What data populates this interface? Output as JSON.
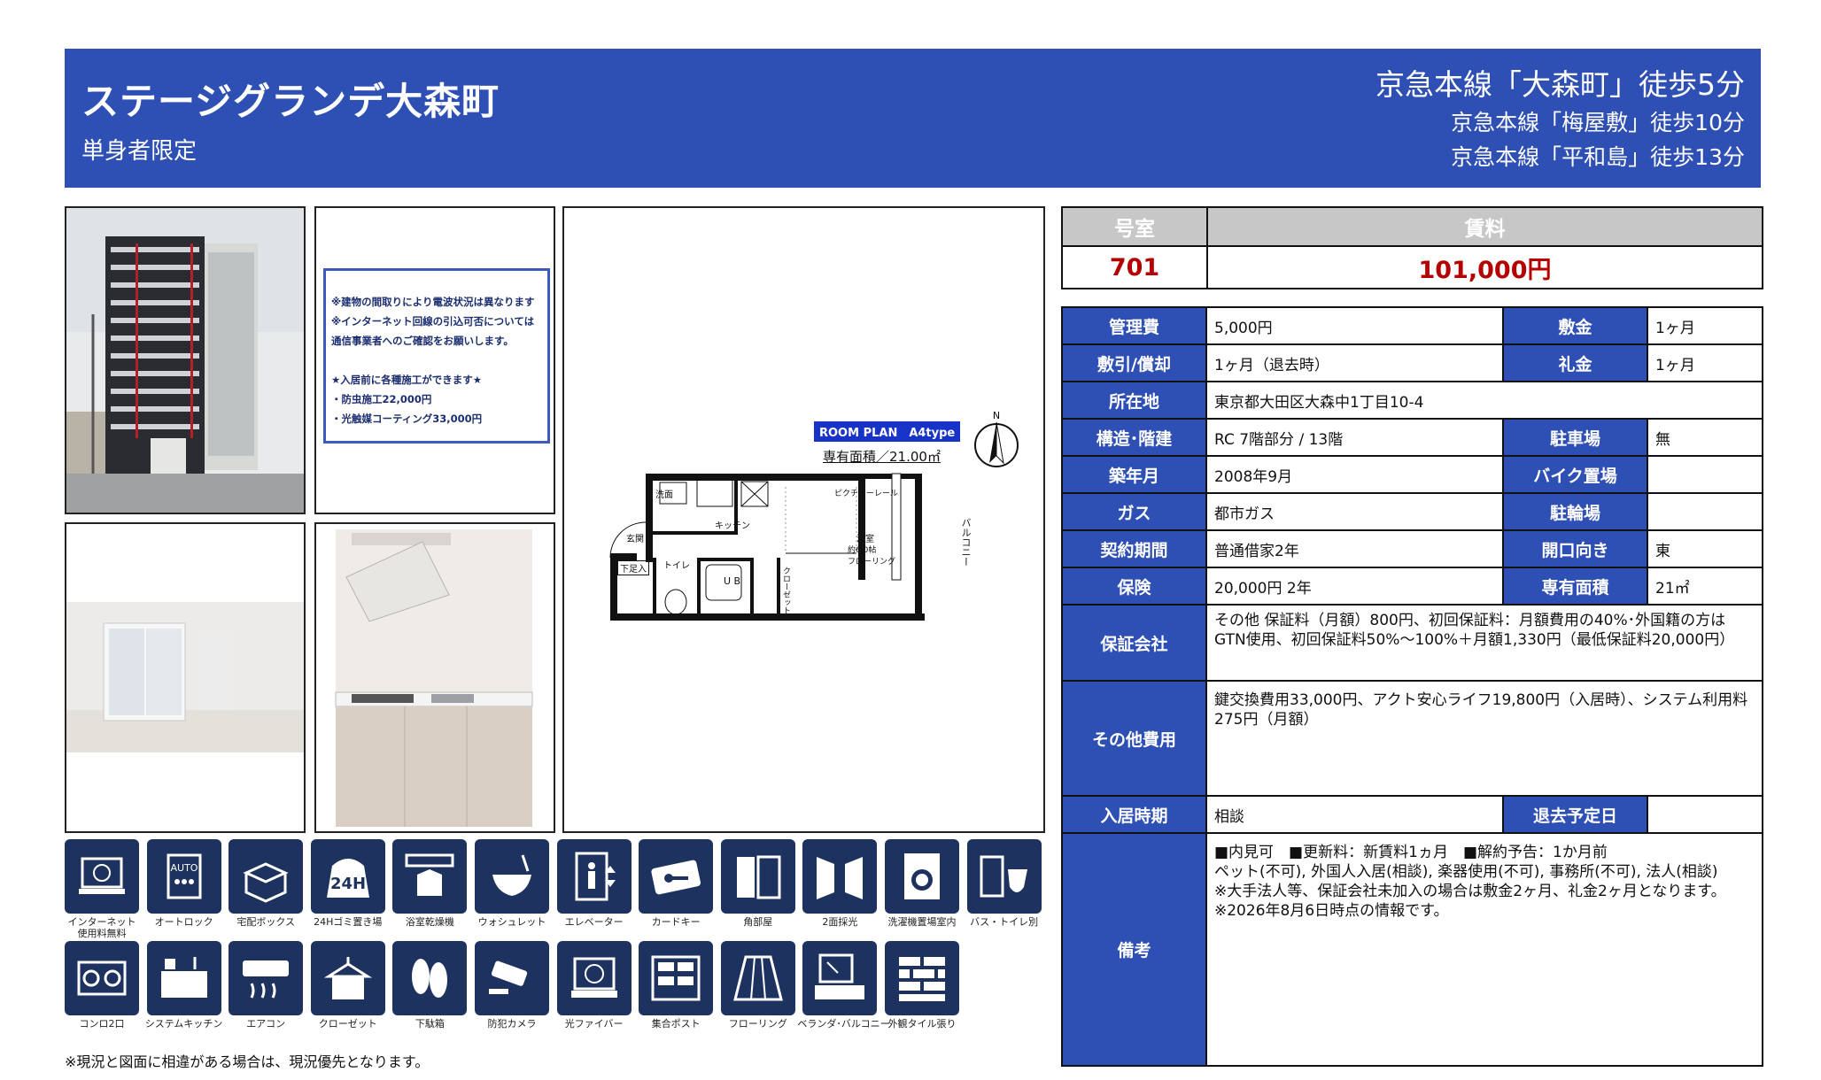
{
  "header": {
    "property_name": "ステージグランデ大森町",
    "subtitle": "単身者限定",
    "stations": [
      "京急本線「大森町」徒歩5分",
      "京急本線「梅屋敷」徒歩10分",
      "京急本線「平和島」徒歩13分"
    ]
  },
  "notice": {
    "lines": [
      "※建物の間取りにより電波状況は異なります",
      "※インターネット回線の引込可否については",
      "通信事業者へのご確認をお願いします。",
      "",
      "★入居前に各種施工ができます★",
      "・防虫施工22,000円",
      "・光触媒コーティング33,000円"
    ]
  },
  "floorplan": {
    "badge": "ROOM PLAN　A4type",
    "area": "専有面積／21.00㎡",
    "north": "N",
    "rooms": {
      "wash": "洗面",
      "kitchen": "キッチン",
      "entrance": "玄関",
      "shoe": "下足入",
      "toilet": "トイレ",
      "ub": "U B",
      "rail": "ピクチャーレール",
      "room": "洋室",
      "room_size": "約6.0帖",
      "floor": "フローリング",
      "closet": "クローゼット",
      "balcony": "バルコニー"
    }
  },
  "rent_table": {
    "room_label": "号室",
    "rent_label": "賃料",
    "room": "701",
    "rent": "101,000円"
  },
  "details": {
    "mgmt_fee_label": "管理費",
    "mgmt_fee": "5,000円",
    "deposit_label": "敷金",
    "deposit": "1ヶ月",
    "refund_label": "敷引/償却",
    "refund": "1ヶ月（退去時）",
    "key_money_label": "礼金",
    "key_money": "1ヶ月",
    "address_label": "所在地",
    "address": "東京都大田区大森中1丁目10-4",
    "structure_label": "構造･階建",
    "structure": "RC 7階部分 / 13階",
    "parking_label": "駐車場",
    "parking": "無",
    "built_label": "築年月",
    "built": "2008年9月",
    "bike_label": "バイク置場",
    "bike": "",
    "gas_label": "ガス",
    "gas": "都市ガス",
    "bicycle_label": "駐輪場",
    "bicycle": "",
    "contract_label": "契約期間",
    "contract": "普通借家2年",
    "facing_label": "開口向き",
    "facing": "東",
    "insurance_label": "保険",
    "insurance": "20,000円 2年",
    "area_label": "専有面積",
    "area": "21㎡",
    "guarantor_label": "保証会社",
    "guarantor": [
      "その他 保証料（月額）800円、初回保証料：月額費用の40%･外国籍の方は",
      "GTN使用、初回保証料50%～100%＋月額1,330円（最低保証料20,000円）"
    ],
    "other_fees_label": "その他費用",
    "other_fees": [
      "鍵交換費用33,000円、アクト安心ライフ19,800円（入居時）、システム利用料",
      "275円（月額）"
    ],
    "move_in_label": "入居時期",
    "move_in": "相談",
    "move_out_label": "退去予定日",
    "move_out": "",
    "remarks_label": "備考",
    "remarks": [
      "■内見可　■更新料：新賃料1ヵ月　■解約予告：1か月前",
      "ペット(不可), 外国人入居(相談), 楽器使用(不可), 事務所(不可), 法人(相談)",
      "※大手法人等、保証会社未加入の場合は敷金2ヶ月、礼金2ヶ月となります。",
      "※2026年8月6日時点の情報です。"
    ]
  },
  "amenities": [
    {
      "label": "インターネット\n使用料無料",
      "icon": "internet-free-icon"
    },
    {
      "label": "オートロック",
      "icon": "auto-lock-icon"
    },
    {
      "label": "宅配ボックス",
      "icon": "delivery-box-icon"
    },
    {
      "label": "24Hゴミ置き場",
      "icon": "24h-garbage-icon"
    },
    {
      "label": "浴室乾燥機",
      "icon": "bathroom-dryer-icon"
    },
    {
      "label": "ウォシュレット",
      "icon": "washlet-icon"
    },
    {
      "label": "エレベーター",
      "icon": "elevator-icon"
    },
    {
      "label": "カードキー",
      "icon": "card-key-icon"
    },
    {
      "label": "角部屋",
      "icon": "corner-room-icon"
    },
    {
      "label": "2面採光",
      "icon": "two-side-light-icon"
    },
    {
      "label": "洗濯機置場室内",
      "icon": "washing-machine-icon"
    },
    {
      "label": "バス・トイレ別",
      "icon": "bath-toilet-separate-icon"
    },
    {
      "label": "コンロ2口",
      "icon": "two-burner-stove-icon"
    },
    {
      "label": "システムキッチン",
      "icon": "system-kitchen-icon"
    },
    {
      "label": "エアコン",
      "icon": "air-conditioner-icon"
    },
    {
      "label": "クローゼット",
      "icon": "closet-icon"
    },
    {
      "label": "下駄箱",
      "icon": "shoe-box-icon"
    },
    {
      "label": "防犯カメラ",
      "icon": "security-camera-icon"
    },
    {
      "label": "光ファイバー",
      "icon": "optical-fiber-icon"
    },
    {
      "label": "集合ポスト",
      "icon": "mailbox-icon"
    },
    {
      "label": "フローリング",
      "icon": "flooring-icon"
    },
    {
      "label": "ベランダ･バルコニー",
      "icon": "balcony-icon"
    },
    {
      "label": "外観タイル張り",
      "icon": "tile-exterior-icon"
    }
  ],
  "footnote": "※現況と図面に相違がある場合は、現況優先となります。"
}
